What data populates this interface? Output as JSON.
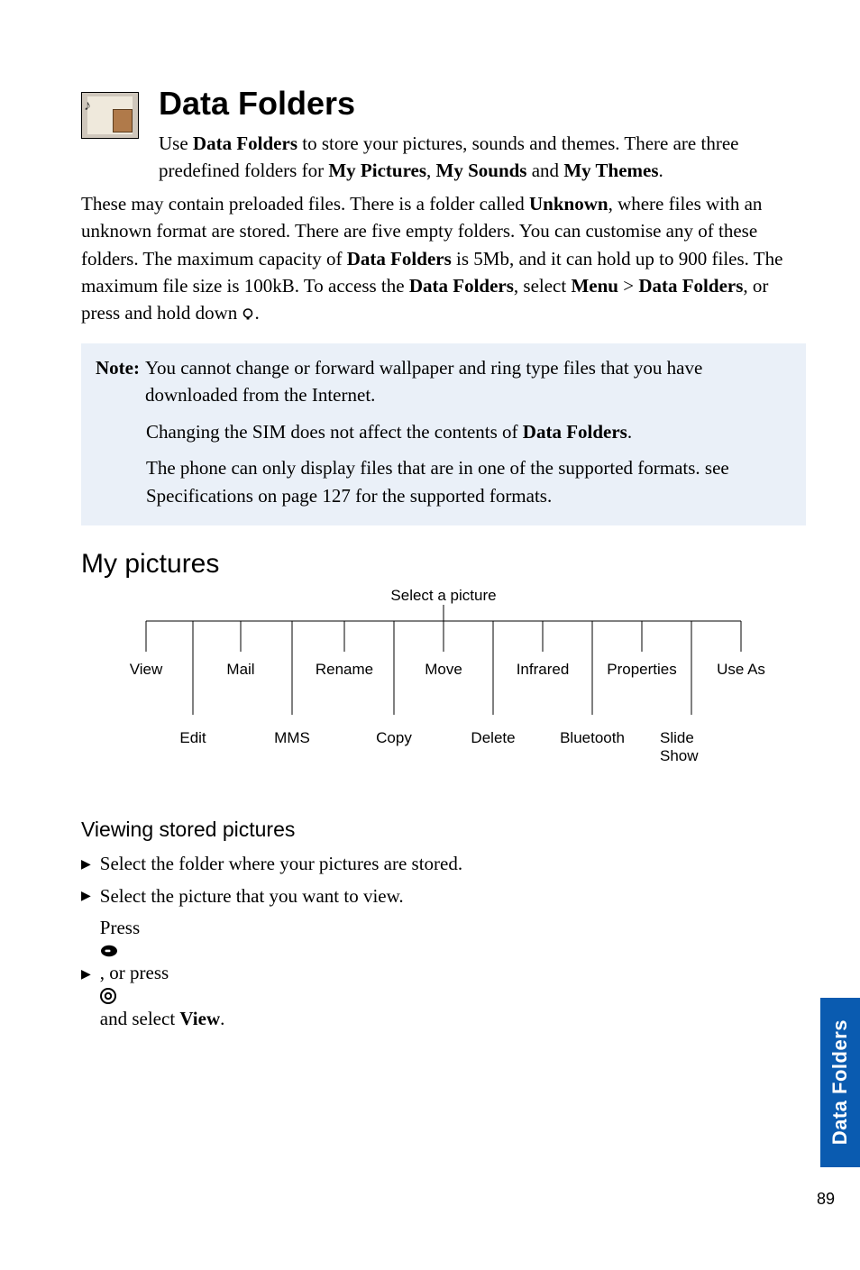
{
  "page_number": "89",
  "side_tab": "Data Folders",
  "header": {
    "title": "Data Folders",
    "intro_lead_pre": "Use ",
    "intro_lead_bold": "Data Folders",
    "intro_lead_post": " to store your pictures, sounds and themes. There are three predefined folders for ",
    "pf1": "My Pictures",
    "comma1": ", ",
    "pf2": "My Sounds",
    "and": " and ",
    "pf3": "My Themes",
    "period": ". "
  },
  "intro_rest": {
    "p1a": "These may contain preloaded files. There is a folder called ",
    "unknown": "Unknown",
    "p1b": ", where files with an unknown format are stored. There are five empty folders. You can customise any of these folders. The maximum capacity of ",
    "df2": "Data Folders",
    "p1c": " is 5Mb, and it can hold up to 900 files. The maximum file size is 100kB. To access the ",
    "df3": "Data Folders",
    "p1d": ", select ",
    "menu": "Menu",
    "gt": " > ",
    "df4": "Data Folders",
    "p1e": ", or press and hold down ",
    "p1f": "."
  },
  "note": {
    "label": "Note:",
    "l1": "You cannot change or forward wallpaper and ring type files that you have downloaded from the Internet.",
    "l2a": "Changing the SIM does not affect the contents of ",
    "l2b": "Data Folders",
    "l2c": ".",
    "l3": "The phone can only display files that are in one of the supported formats. see Specifications on page 127 for the supported formats."
  },
  "section_title": "My pictures",
  "tree": {
    "root": "Select a picture",
    "row1": [
      "View",
      "Mail",
      "Rename",
      "Move",
      "Infrared",
      "Properties",
      "Use As"
    ],
    "row2": [
      "Edit",
      "MMS",
      "Copy",
      "Delete",
      "Bluetooth",
      "Slide Show"
    ]
  },
  "subhead": "Viewing stored pictures",
  "steps": {
    "s1": "Select the folder where your pictures are stored.",
    "s2": "Select the picture that you want to view.",
    "s3a": "Press ",
    "s3b": ", or press ",
    "s3c": " and select ",
    "s3d": "View",
    "s3e": "."
  }
}
